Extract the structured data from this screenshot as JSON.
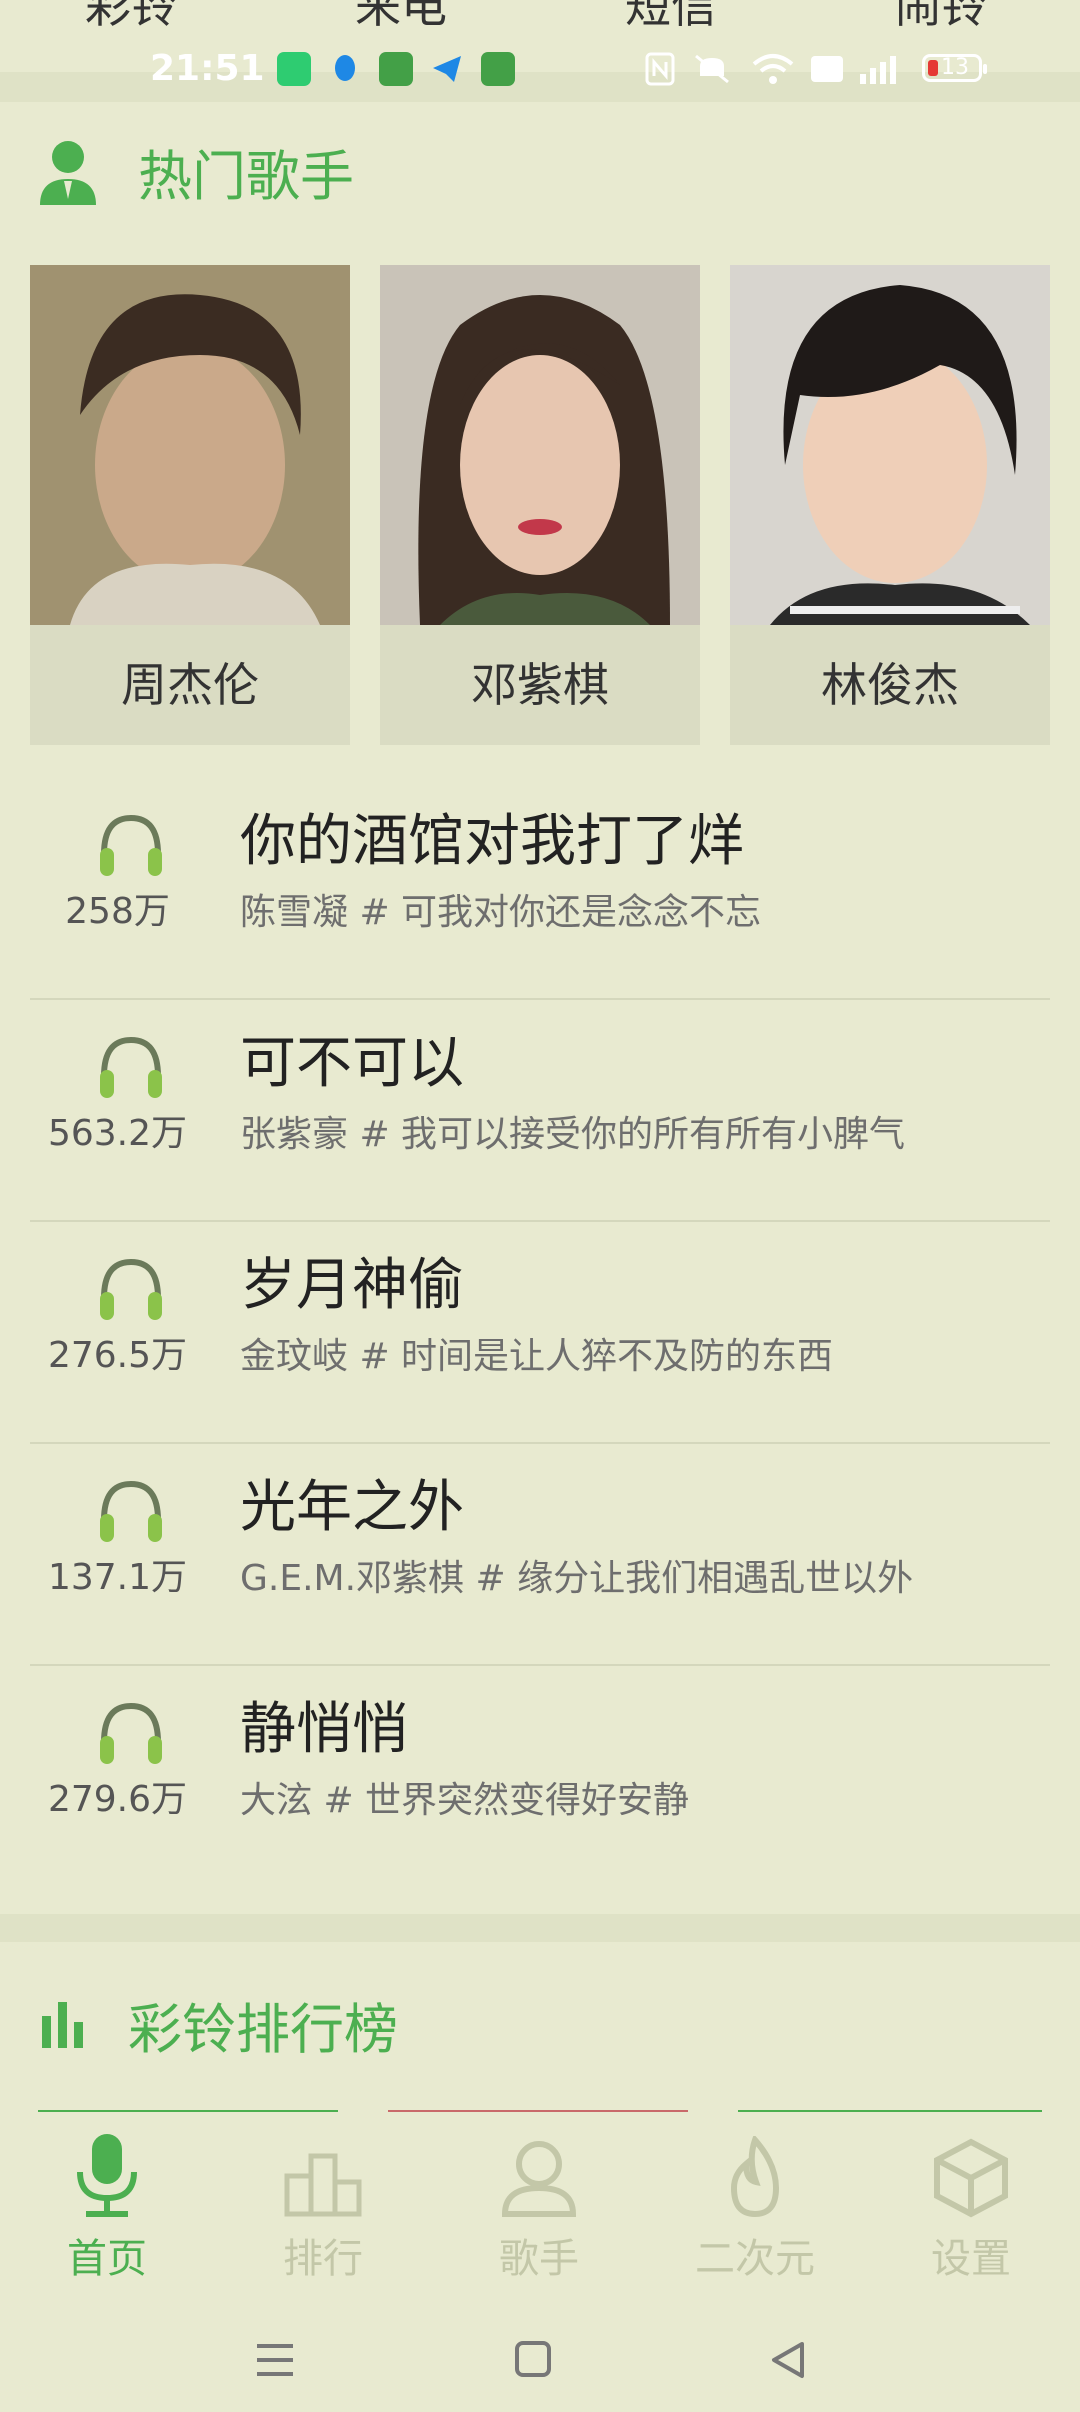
{
  "top_tabs": [
    "彩铃",
    "来电",
    "短信",
    "闹铃"
  ],
  "status_bar": {
    "time": "21:51",
    "battery": "13"
  },
  "hot_singers": {
    "title": "热门歌手",
    "singers": [
      {
        "name": "周杰伦"
      },
      {
        "name": "邓紫棋"
      },
      {
        "name": "林俊杰"
      }
    ]
  },
  "songs": [
    {
      "title": "你的酒馆对我打了烊",
      "subtitle": "陈雪凝 # 可我对你还是念念不忘",
      "plays": "258万"
    },
    {
      "title": "可不可以",
      "subtitle": "张紫豪 # 我可以接受你的所有所有小脾气",
      "plays": "563.2万"
    },
    {
      "title": "岁月神偷",
      "subtitle": "金玟岐 # 时间是让人猝不及防的东西",
      "plays": "276.5万"
    },
    {
      "title": "光年之外",
      "subtitle": "G.E.M.邓紫棋 # 缘分让我们相遇乱世以外",
      "plays": "137.1万"
    },
    {
      "title": "静悄悄",
      "subtitle": "大泫 # 世界突然变得好安静",
      "plays": "279.6万"
    }
  ],
  "ranking": {
    "title": "彩铃排行榜"
  },
  "bottom_nav": [
    {
      "label": "首页",
      "active": true
    },
    {
      "label": "排行",
      "active": false
    },
    {
      "label": "歌手",
      "active": false
    },
    {
      "label": "二次元",
      "active": false
    },
    {
      "label": "设置",
      "active": false
    }
  ],
  "colors": {
    "accent": "#4caf50",
    "background": "#e8ead0",
    "inactive": "#c3c7a8"
  }
}
